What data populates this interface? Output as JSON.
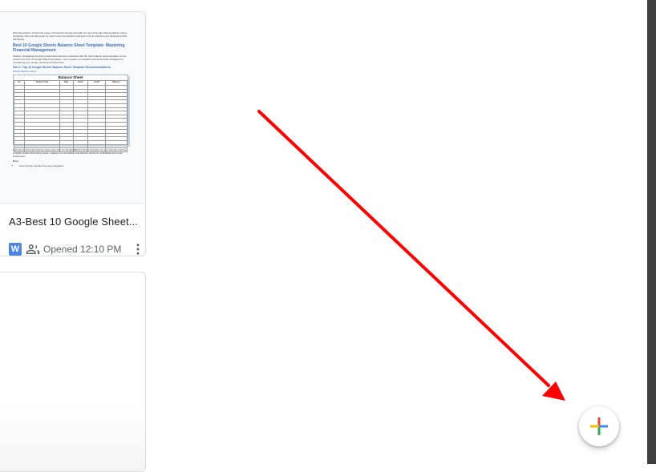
{
  "doc_card": {
    "title": "A3-Best 10 Google Sheet...",
    "app_badge": "W",
    "opened_text": "Opened 12:10 PM",
    "icons": {
      "app": "word-doc-icon",
      "shared": "people-icon",
      "more": "more-vert-icon"
    }
  },
  "preview": {
    "meta_description": "Meta Description: Unlock the power of financial management with our top 10 Google Sheets balance sheet templates. Dive into this guide for expert recommendations and learn how to enhance your financial control effortlessly.",
    "heading": "Best 10 Google Sheets Balance Sheet Template: Mastering Financial Management",
    "preface": "Preface: Navigating financial complexities becomes seamless with the right balance sheet template. As we explore the best 10 Google Sheets templates, I aim to guide you towards optimal financial management, considering your unique needs and preferences.",
    "part_heading": "Part 1: Top 10 Google Sheets Balance Sheet Template Recommendations",
    "sub_heading": "Simple Balance Sheet",
    "sheet_title": "Balance Sheet",
    "sheet_columns": [
      "No.",
      "Subject Code",
      "Date",
      "Debit",
      "Credit",
      "Balance"
    ],
    "body": "Experience financial tracking made easy with the Simple Balance Sheet template. Its user-friendly interface simplifies basic accounting needs, making it an accessible and efficient choice for individuals and small businesses.",
    "pros_label": "Pros:",
    "pros_item": "User-friendly interface for easy navigation."
  },
  "fab": {
    "icon": "plus-icon",
    "colors": [
      "#ea4335",
      "#fbbc04",
      "#34a853",
      "#4285f4"
    ]
  },
  "annotation": {
    "color": "#ff0000"
  },
  "colors": {
    "badge_blue": "#4a86e8",
    "dark_bar": "#3c4043"
  }
}
